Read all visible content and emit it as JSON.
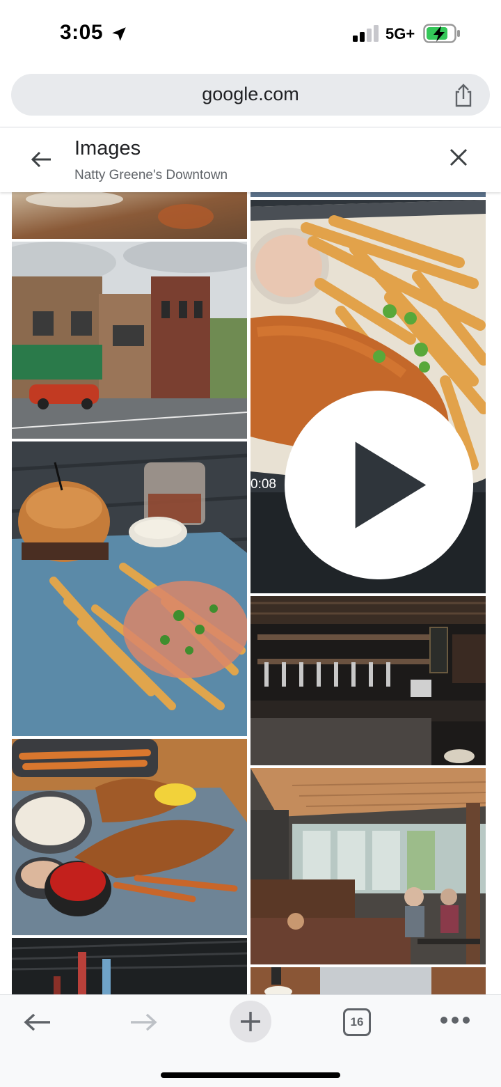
{
  "status_bar": {
    "time": "3:05",
    "network": "5G+",
    "icons": [
      "location-arrow-icon",
      "signal-icon",
      "battery-charging-icon"
    ]
  },
  "url_bar": {
    "url": "google.com",
    "share_icon": "share-icon"
  },
  "images_header": {
    "title": "Images",
    "subtitle": "Natty Greene's Downtown",
    "back_icon": "back-arrow-icon",
    "close_icon": "close-icon"
  },
  "image_grid": {
    "left_column": [
      "partial-top-image",
      "building-exterior",
      "burger-and-fries",
      "fried-fish-plate",
      "bar-interior-partial"
    ],
    "right_column": [
      "partial-top-image",
      "fried-fish-and-fries-video",
      "bar-taps",
      "dining-room",
      "ceiling-partial"
    ],
    "video": {
      "duration": "0:08"
    }
  },
  "toolbar": {
    "tab_count": "16",
    "icons": [
      "back-icon",
      "forward-icon",
      "new-tab-icon",
      "tabs-icon",
      "more-icon"
    ]
  },
  "colors": {
    "url_bar_bg": "#e8eaed",
    "toolbar_bg": "#f8f9fa",
    "accent_green": "#1e8e3e"
  }
}
